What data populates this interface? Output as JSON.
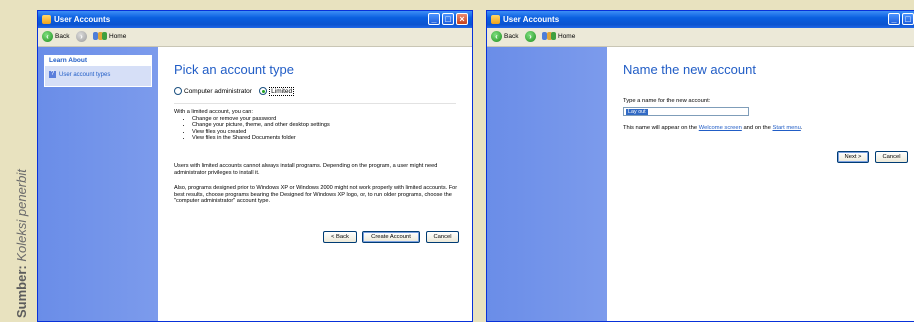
{
  "caption": {
    "label": "Sumber:",
    "source": "Koleksi penerbit"
  },
  "windows": {
    "left": {
      "title": "User Accounts",
      "toolbar": {
        "back_label": "Back",
        "home_label": "Home"
      },
      "sidebar": {
        "heading": "Learn About",
        "item": "User account types"
      },
      "page_title": "Pick an account type",
      "radio_options": [
        {
          "label": "Computer administrator",
          "selected": false
        },
        {
          "label": "Limited",
          "selected": true
        }
      ],
      "intro": "With a limited account, you can:",
      "bullets": [
        "Change or remove your password",
        "Change your picture, theme, and other desktop settings",
        "View files you created",
        "View files in the Shared Documents folder"
      ],
      "para1": "Users with limited accounts cannot always install programs. Depending on the program, a user might need administrator privileges to install it.",
      "para2": "Also, programs designed prior to Windows XP or Windows 2000 might not work properly with limited accounts. For best results, choose programs bearing the Designed for Windows XP logo, or, to run older programs, choose the \"computer administrator\" account type.",
      "buttons": {
        "back": "< Back",
        "create": "Create Account",
        "cancel": "Cancel"
      }
    },
    "right": {
      "title": "User Accounts",
      "toolbar": {
        "back_label": "Back",
        "home_label": "Home"
      },
      "page_title": "Name the new account",
      "field_label": "Type a name for the new account:",
      "field_value": "Lay out",
      "note_prefix": "This name will appear on the",
      "note_link1": "Welcome screen",
      "note_mid": "and on the",
      "note_link2": "Start menu",
      "note_suffix": ".",
      "buttons": {
        "next": "Next >",
        "cancel": "Cancel"
      }
    }
  },
  "colors": {
    "title_blue": "#215dc6",
    "sidebar_blue": "#7c9bec",
    "titlebar": "#0a5fe0"
  }
}
